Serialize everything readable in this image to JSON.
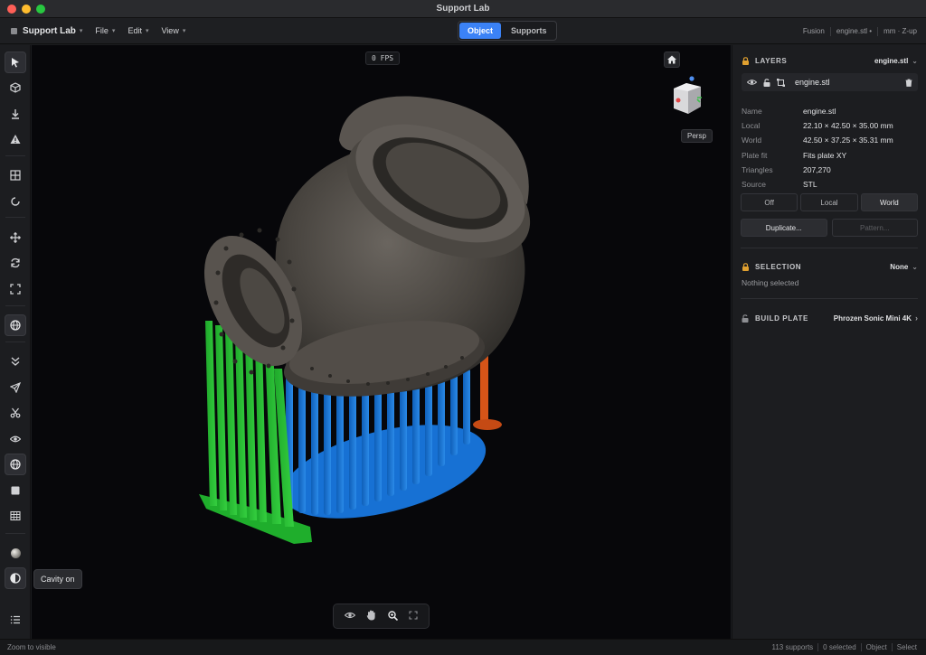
{
  "window": {
    "title": "Support Lab"
  },
  "menubar": {
    "app_name": "Support Lab",
    "menus": [
      "File",
      "Edit",
      "View"
    ],
    "mode_tabs": [
      "Object",
      "Supports"
    ],
    "active_mode": "Object",
    "right": {
      "engine": "Fusion",
      "file": "engine.stl •",
      "units": "mm · Z-up"
    }
  },
  "toolbar": {
    "tools": [
      "select-cursor-icon",
      "cube-icon",
      "download-icon",
      "warning-icon",
      "grid-icon",
      "rotate-circle-icon",
      "move-icon",
      "refresh-icon",
      "fit-frame-icon",
      "globe-icon",
      "chevrons-down-icon",
      "send-icon",
      "scissors-icon",
      "eye-icon",
      "globe-icon",
      "square-icon",
      "table-icon",
      "sphere-icon",
      "contrast-icon",
      "list-icon"
    ],
    "tooltip": "Cavity on"
  },
  "viewport": {
    "fps": "0 FPS",
    "camera_mode": "Persp",
    "bottom_tools": [
      "eye-icon",
      "hand-icon",
      "zoom-icon",
      "fullscreen-icon"
    ]
  },
  "panel": {
    "layers": {
      "title": "LAYERS",
      "value": "engine.stl",
      "layer_name": "engine.stl",
      "props": [
        {
          "key": "Name",
          "value": "engine.stl"
        },
        {
          "key": "Local",
          "value": "22.10 × 42.50 × 35.00 mm"
        },
        {
          "key": "World",
          "value": "42.50 × 37.25 × 35.31 mm"
        },
        {
          "key": "Plate fit",
          "value": "Fits plate XY"
        },
        {
          "key": "Triangles",
          "value": "207,270"
        },
        {
          "key": "Source",
          "value": "STL"
        }
      ],
      "space_buttons": [
        "Off",
        "Local",
        "World"
      ],
      "active_space": "World",
      "duplicate": "Duplicate...",
      "pattern": "Pattern..."
    },
    "selection": {
      "title": "SELECTION",
      "value": "None",
      "empty": "Nothing selected"
    },
    "build_plate": {
      "title": "BUILD PLATE",
      "value": "Phrozen Sonic Mini 4K"
    }
  },
  "statusbar": {
    "hint": "Zoom to visible",
    "supports": "113 supports",
    "selected": "0 selected",
    "mode": "Object",
    "tool": "Select"
  },
  "colors": {
    "accent": "#3b82f6",
    "support_green": "#22b530",
    "support_blue": "#1673d6",
    "support_orange": "#d9541a",
    "model": "#4e4a46"
  }
}
